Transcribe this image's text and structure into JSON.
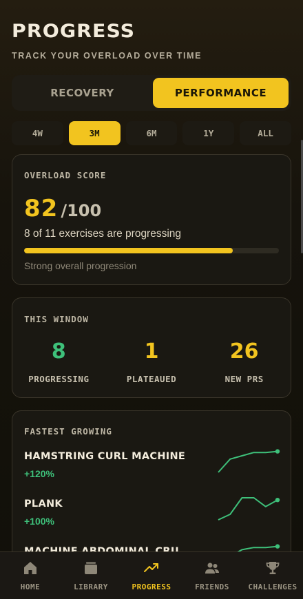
{
  "header": {
    "title": "PROGRESS",
    "subtitle": "TRACK YOUR OVERLOAD OVER TIME"
  },
  "mode_toggle": {
    "options": [
      "RECOVERY",
      "PERFORMANCE"
    ],
    "selected": "PERFORMANCE"
  },
  "periods": {
    "options": [
      "4W",
      "3M",
      "6M",
      "1Y",
      "ALL"
    ],
    "selected": "3M"
  },
  "overload": {
    "label": "OVERLOAD SCORE",
    "score": "82",
    "max": "/100",
    "description": "8 of 11 exercises are progressing",
    "progress_fraction": 0.82,
    "note": "Strong overall progression"
  },
  "window": {
    "label": "THIS WINDOW",
    "stats": [
      {
        "value": "8",
        "label": "PROGRESSING",
        "color": "#3ec07a"
      },
      {
        "value": "1",
        "label": "PLATEAUED",
        "color": "#f2c41f"
      },
      {
        "value": "26",
        "label": "NEW PRS",
        "color": "#f2c41f"
      }
    ]
  },
  "fastest": {
    "label": "FASTEST GROWING",
    "items": [
      {
        "name": "HAMSTRING CURL MACHINE",
        "pct": "+120%",
        "trend": [
          0,
          0.6,
          0.75,
          0.9,
          0.9,
          0.95
        ]
      },
      {
        "name": "PLANK",
        "pct": "+100%",
        "trend": [
          0,
          0.25,
          1.0,
          1.0,
          0.6,
          0.9
        ]
      },
      {
        "name": "MACHINE ABDOMINAL CRU",
        "pct": "",
        "trend": [
          0,
          0.5,
          0.8,
          0.9,
          0.9,
          0.95
        ]
      }
    ]
  },
  "nav": {
    "items": [
      {
        "label": "HOME",
        "icon": "home-icon"
      },
      {
        "label": "LIBRARY",
        "icon": "library-icon"
      },
      {
        "label": "PROGRESS",
        "icon": "trending-up-icon"
      },
      {
        "label": "FRIENDS",
        "icon": "friends-icon"
      },
      {
        "label": "CHALLENGES",
        "icon": "trophy-icon"
      }
    ],
    "active": "PROGRESS"
  },
  "colors": {
    "accent": "#f2c41f",
    "positive": "#3ec07a",
    "background": "#16130c"
  }
}
